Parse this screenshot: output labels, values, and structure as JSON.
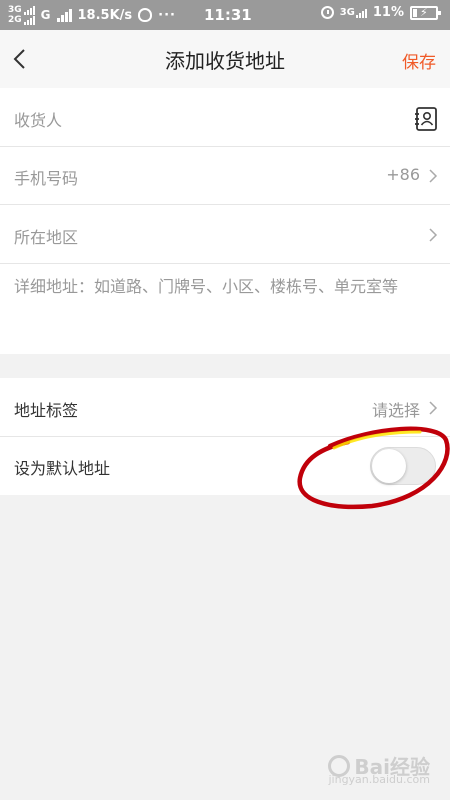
{
  "status_bar": {
    "net_top": "3G",
    "net_bottom": "2G",
    "g_label": "G",
    "speed": "18.5K/s",
    "dots": "···",
    "time": "11:31",
    "net_right": "3G",
    "battery_pct": "11%"
  },
  "header": {
    "title": "添加收货地址",
    "save_label": "保存"
  },
  "form": {
    "recipient_placeholder": "收货人",
    "phone_placeholder": "手机号码",
    "phone_prefix": "+86",
    "region_placeholder": "所在地区",
    "detail_placeholder": "详细地址：如道路、门牌号、小区、楼栋号、单元室等"
  },
  "options": {
    "tag_label": "地址标签",
    "tag_value": "请选择",
    "default_label": "设为默认地址",
    "default_enabled": false
  },
  "watermark": {
    "text": "Bai经验",
    "sub": "jingyan.baidu.com"
  },
  "colors": {
    "accent": "#f05a28",
    "annotation": "#c0000a"
  }
}
